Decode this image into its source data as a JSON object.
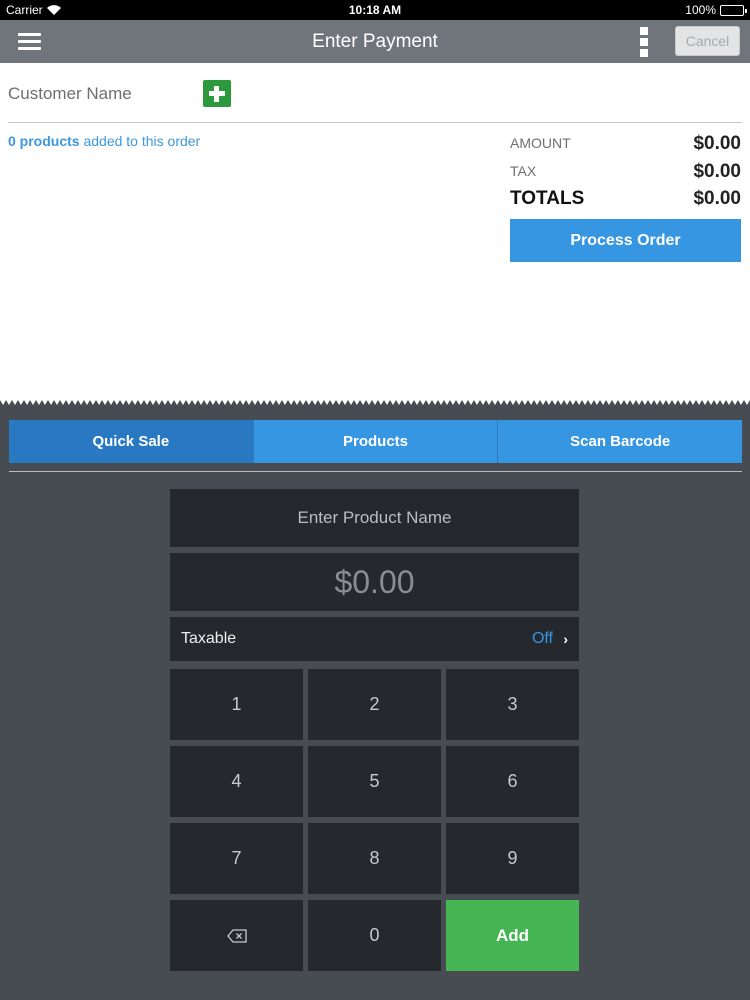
{
  "status_bar": {
    "carrier": "Carrier",
    "time": "10:18 AM",
    "battery": "100%"
  },
  "nav": {
    "title": "Enter Payment",
    "cancel_label": "Cancel"
  },
  "order": {
    "customer_label": "Customer Name",
    "products_count": "0 products",
    "products_suffix": "added to this order",
    "amount_label": "AMOUNT",
    "amount_value": "$0.00",
    "tax_label": "TAX",
    "tax_value": "$0.00",
    "totals_label": "TOTALS",
    "totals_value": "$0.00",
    "process_label": "Process Order"
  },
  "tabs": [
    {
      "label": "Quick Sale",
      "active": true
    },
    {
      "label": "Products",
      "active": false
    },
    {
      "label": "Scan Barcode",
      "active": false
    }
  ],
  "entry": {
    "product_name_placeholder": "Enter Product Name",
    "price": "$0.00",
    "taxable_label": "Taxable",
    "taxable_value": "Off"
  },
  "keypad": {
    "keys": [
      "1",
      "2",
      "3",
      "4",
      "5",
      "6",
      "7",
      "8",
      "9",
      "0"
    ],
    "add_label": "Add"
  },
  "icons": {
    "menu": "hamburger-menu-icon",
    "more": "kebab-menu-icon",
    "add_customer": "plus-icon",
    "backspace": "backspace-icon",
    "chevron": "chevron-right-icon"
  },
  "colors": {
    "accent": "#3796e1",
    "accent_active": "#2878c2",
    "add_green": "#45b554",
    "plus_green": "#2c9a3c",
    "keypad_bg": "#25282d",
    "background": "#474c53",
    "nav_bar": "#70757b"
  }
}
